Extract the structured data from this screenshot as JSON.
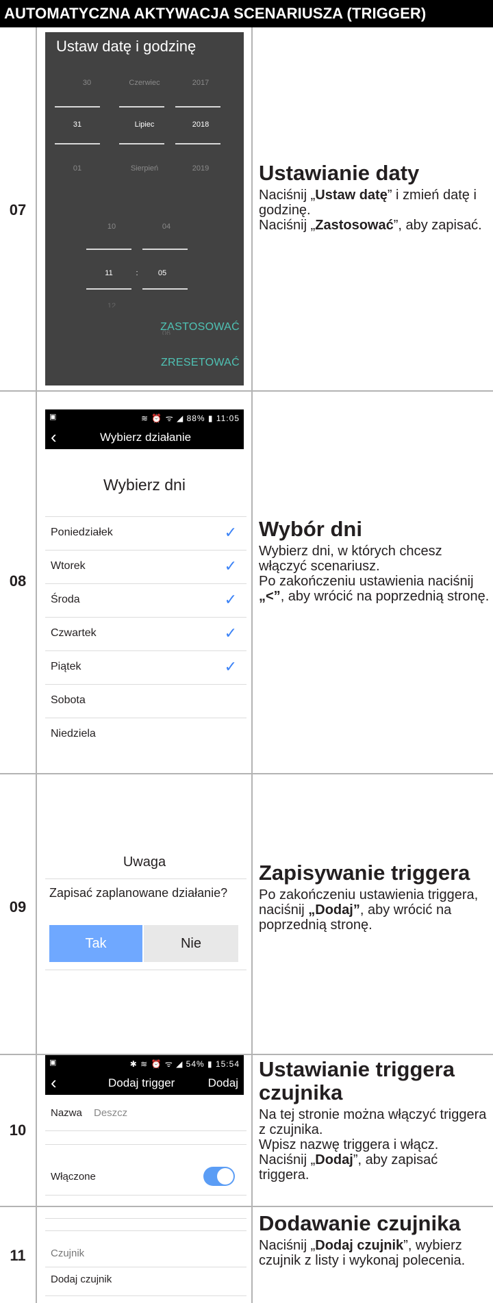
{
  "header": {
    "title": "AUTOMATYCZNA AKTYWACJA SCENARIUSZA (TRIGGER)"
  },
  "steps": [
    {
      "number": "07",
      "title": "Ustawianie daty",
      "text_parts": [
        "Naciśnij „",
        "Ustaw datę",
        "” i zmień datę i godzinę.",
        "Naciśnij „",
        "Zastosować",
        "”, aby zapisać."
      ],
      "screen": {
        "title": "Ustaw datę i godzinę",
        "date_prev": [
          "30",
          "Czerwiec",
          "2017"
        ],
        "date_sel": [
          "31",
          "Lipiec",
          "2018"
        ],
        "date_next": [
          "01",
          "Sierpień",
          "2019"
        ],
        "time_prev": [
          "10",
          "04"
        ],
        "time_sel": [
          "11",
          ":",
          "05"
        ],
        "time_next": [
          "12",
          "06"
        ],
        "apply": "ZASTOSOWAĆ",
        "reset": "ZRESETOWAĆ"
      }
    },
    {
      "number": "08",
      "title": "Wybór dni",
      "text_parts": [
        "Wybierz dni, w których chcesz włączyć scenariusz.",
        "Po zakończeniu ustawienia naciśnij ",
        "„<”",
        ", aby wrócić na poprzednią stronę."
      ],
      "screen": {
        "status_left": "▣",
        "status_right": "≋ ⏰ ᯤ ◢ 88% ▮ 11:05",
        "back": "‹",
        "nav_title": "Wybierz działanie",
        "heading": "Wybierz dni",
        "days": [
          {
            "label": "Poniedziałek",
            "checked": true
          },
          {
            "label": "Wtorek",
            "checked": true
          },
          {
            "label": "Środa",
            "checked": true
          },
          {
            "label": "Czwartek",
            "checked": true
          },
          {
            "label": "Piątek",
            "checked": true
          },
          {
            "label": "Sobota",
            "checked": false
          },
          {
            "label": "Niedziela",
            "checked": false
          }
        ],
        "check_mark": "✓"
      }
    },
    {
      "number": "09",
      "title": "Zapisywanie triggera",
      "text_parts": [
        "Po zakończeniu ustawienia triggera, naciśnij ",
        "„Dodaj”",
        ", aby wrócić na poprzednią stronę."
      ],
      "screen": {
        "heading": "Uwaga",
        "question": "Zapisać zaplanowane działanie?",
        "yes": "Tak",
        "no": "Nie"
      }
    },
    {
      "number": "10",
      "title": "Ustawianie triggera czujnika",
      "text_parts": [
        "Na tej stronie można włączyć triggera z czujnika.",
        "Wpisz nazwę triggera i włącz.",
        "Naciśnij „",
        "Dodaj",
        "”, aby zapisać triggera."
      ],
      "screen": {
        "status_left": "▣",
        "status_right": "✱ ≋ ⏰ ᯤ ◢ 54% ▮ 15:54",
        "back": "‹",
        "nav_title": "Dodaj trigger",
        "nav_action": "Dodaj",
        "name_label": "Nazwa",
        "name_value": "Deszcz",
        "enabled_label": "Włączone",
        "enabled": true
      }
    },
    {
      "number": "11",
      "title": "Dodawanie czujnika",
      "text_parts": [
        "Naciśnij „",
        "Dodaj czujnik",
        "”, wybierz czujnik z listy i wykonaj polecenia."
      ],
      "screen": {
        "section": "Czujnik",
        "add": "Dodaj czujnik"
      }
    }
  ]
}
